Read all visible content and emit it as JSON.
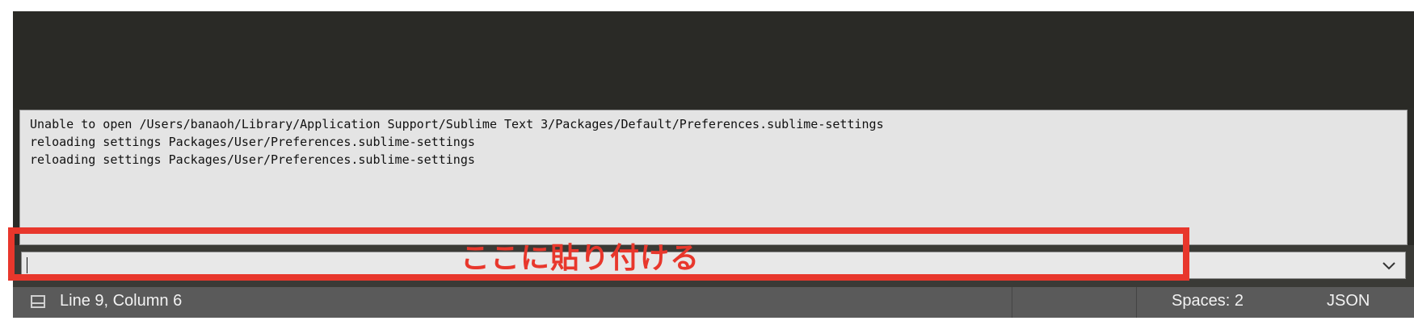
{
  "console": {
    "lines": [
      "Unable to open /Users/banaoh/Library/Application Support/Sublime Text 3/Packages/Default/Preferences.sublime-settings",
      "reloading settings Packages/User/Preferences.sublime-settings",
      "reloading settings Packages/User/Preferences.sublime-settings"
    ]
  },
  "input": {
    "value": "",
    "dropdown_icon": "chevron-down-icon"
  },
  "annotation": {
    "text": "ここに貼り付ける",
    "color": "#e8372c"
  },
  "status_bar": {
    "panel_icon": "panel-icon",
    "position": "Line 9, Column 6",
    "indentation": "Spaces: 2",
    "syntax": "JSON"
  }
}
